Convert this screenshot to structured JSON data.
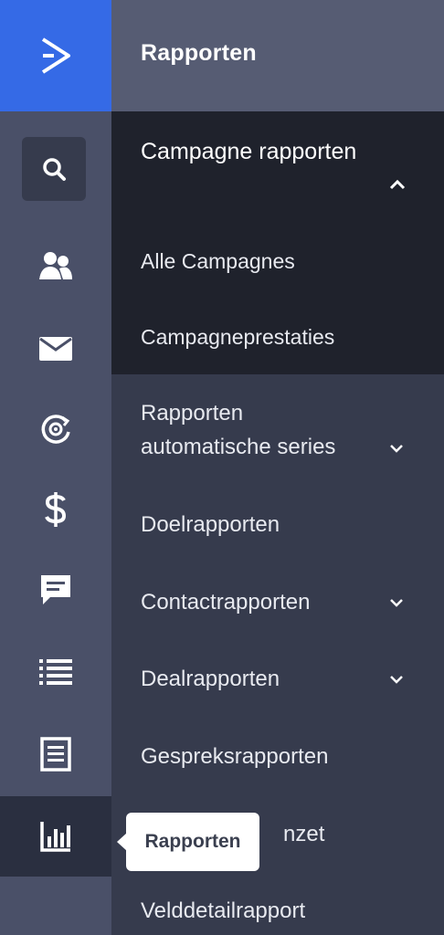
{
  "rail": {
    "items": [
      {
        "name": "search",
        "icon": "search-icon"
      },
      {
        "name": "contacts",
        "icon": "contacts-icon"
      },
      {
        "name": "campaigns",
        "icon": "envelope-icon"
      },
      {
        "name": "automations",
        "icon": "automation-cycle-icon"
      },
      {
        "name": "deals",
        "icon": "dollar-icon"
      },
      {
        "name": "conversations",
        "icon": "chat-icon"
      },
      {
        "name": "lists",
        "icon": "list-icon"
      },
      {
        "name": "forms",
        "icon": "document-icon"
      },
      {
        "name": "reports",
        "icon": "bar-chart-icon",
        "active": true
      }
    ]
  },
  "panel": {
    "title": "Rapporten",
    "section_open": {
      "label": "Campagne rapporten",
      "items": [
        "Alle Campagnes",
        "Campagneprestaties"
      ]
    },
    "items": [
      {
        "label_line1": "Rapporten",
        "label_line2": "automatische series",
        "has_chevron": true
      },
      {
        "label": "Doelrapporten"
      },
      {
        "label": "Contactrapporten",
        "has_chevron": true
      },
      {
        "label": "Dealrapporten",
        "has_chevron": true
      },
      {
        "label": "Gespreksrapporten"
      },
      {
        "label_visible": "nzet"
      },
      {
        "label": "Velddetailrapport"
      }
    ]
  },
  "tooltip": {
    "text": "Rapporten"
  },
  "colors": {
    "brand_blue": "#356ae6",
    "rail_bg": "#4a5068",
    "panel_bg": "#363b4d",
    "submenu_bg": "#1f222c",
    "header_bg": "#565c73"
  }
}
